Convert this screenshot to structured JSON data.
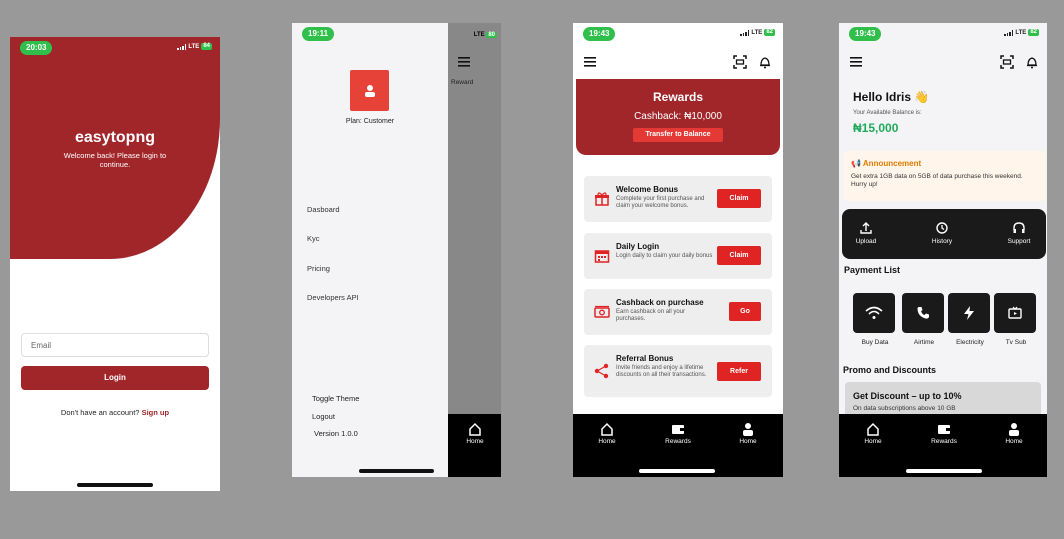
{
  "login_screen": {
    "time": "20:03",
    "network": "LTE",
    "battery": "84",
    "brand": "easytopng",
    "welcome": "Welcome back! Please login to continue.",
    "email_placeholder": "Email",
    "login_label": "Login",
    "signup_prompt": "Don't have an account?",
    "signup_link": "Sign up",
    "accent": "#a1262a"
  },
  "drawer_screen": {
    "time": "19:11",
    "network": "LTE",
    "battery": "80",
    "plan": "Plan: Customer",
    "menu": [
      "Dasboard",
      "Kyc",
      "Pricing",
      "Developers API"
    ],
    "toggle_theme": "Toggle Theme",
    "logout": "Logout",
    "version": "Version 1.0.0",
    "peek_title": "Reward",
    "peek_tab": "Home"
  },
  "rewards_screen": {
    "time": "19:43",
    "network": "LTE",
    "battery": "82",
    "title": "Rewards",
    "cashback": "Cashback: ₦10,000",
    "transfer_label": "Transfer to Balance",
    "cards": [
      {
        "icon": "gift-icon",
        "title": "Welcome Bonus",
        "desc": "Complete your first purchase and claim your welcome bonus.",
        "button": "Claim"
      },
      {
        "icon": "calendar-icon",
        "title": "Daily Login",
        "desc": "Login daily to claim your daily bonus",
        "button": "Claim"
      },
      {
        "icon": "cash-icon",
        "title": "Cashback on purchase",
        "desc": "Earn cashback on all your purchases.",
        "button": "Go"
      },
      {
        "icon": "share-icon",
        "title": "Referral Bonus",
        "desc": "Invite friends and enjoy a lifetime discounts on all their transactions.",
        "button": "Refer"
      }
    ],
    "tabs": [
      "Home",
      "Rewards",
      "Home"
    ]
  },
  "home_screen": {
    "time": "19:43",
    "network": "LTE",
    "battery": "82",
    "greeting": "Hello Idris 👋",
    "balance_label": "Your Available Balance is:",
    "balance": "₦15,000",
    "announcement_title": "Announcement",
    "announcement_text": "Get extra 1GB data on 5GB of data purchase this weekend. Hurry up!",
    "quick_actions": [
      "Upload",
      "History",
      "Support"
    ],
    "payment_list_title": "Payment List",
    "payments": [
      "Buy Data",
      "Airtime",
      "Electricity",
      "Tv Sub"
    ],
    "promo_title": "Promo and Discounts",
    "discount_title": "Get Discount – up to 10%",
    "discount_text": "On data subscriptions above 10 GB",
    "tabs": [
      "Home",
      "Rewards",
      "Home"
    ]
  }
}
